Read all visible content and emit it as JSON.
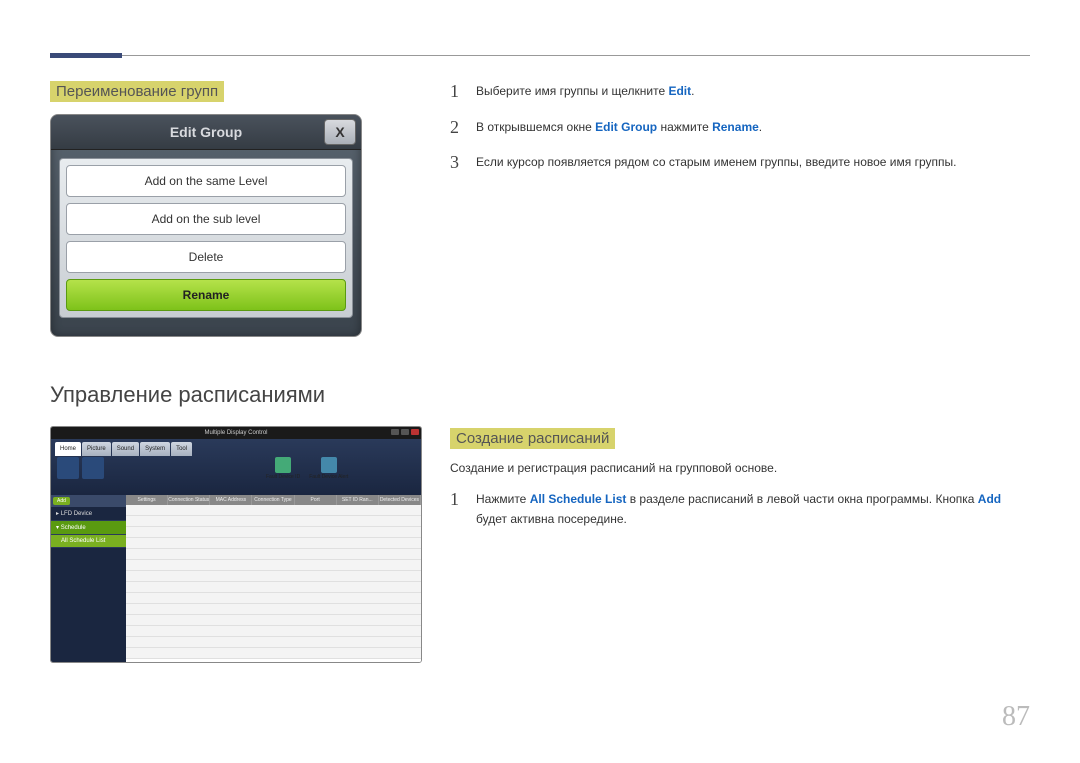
{
  "section1": {
    "title": "Переименование групп",
    "dialog": {
      "title": "Edit Group",
      "close": "X",
      "items": [
        "Add on the same Level",
        "Add on the sub level",
        "Delete",
        "Rename"
      ]
    },
    "steps": [
      {
        "n": "1",
        "pre": "Выберите имя группы и щелкните ",
        "hl": "Edit",
        "post": "."
      },
      {
        "n": "2",
        "pre": "В открывшемся окне ",
        "hl": "Edit Group",
        "mid": " нажмите ",
        "hl2": "Rename",
        "post": "."
      },
      {
        "n": "3",
        "pre": "Если курсор появляется рядом со старым именем группы, введите новое имя группы."
      }
    ]
  },
  "section2": {
    "heading": "Управление расписаниями",
    "title": "Создание расписаний",
    "desc": "Создание и регистрация расписаний на групповой основе.",
    "steps": [
      {
        "n": "1",
        "pre": "Нажмите ",
        "hl": "All Schedule List",
        "mid": " в разделе расписаний в левой части окна программы. Кнопка ",
        "hl2": "Add",
        "post": " будет активна посередине."
      }
    ],
    "app": {
      "title": "Multiple Display Control",
      "tabs": [
        "Home",
        "Picture",
        "Sound",
        "System",
        "Tool"
      ],
      "ribbon_labels": [
        "Fault Device ID",
        "Fault Device Alert"
      ],
      "sidebar": {
        "add_btn": "Add",
        "items": [
          "LFD Device",
          "Schedule",
          "All Schedule List"
        ]
      },
      "grid_headers": [
        "Settings",
        "Connection Status",
        "MAC Address",
        "Connection Type",
        "Port",
        "SET ID Ran...",
        "Detected Devices"
      ]
    }
  },
  "pageNumber": "87"
}
